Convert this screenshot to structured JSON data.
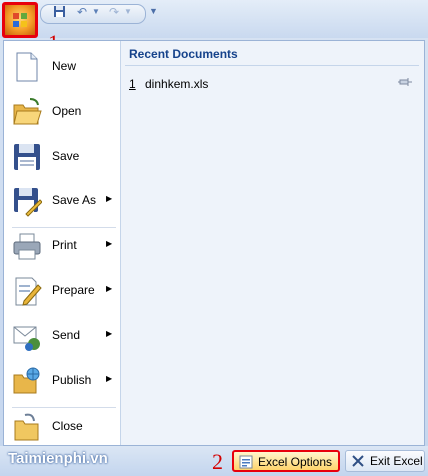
{
  "callouts": {
    "step1": "1",
    "step2": "2"
  },
  "menu": {
    "items": [
      {
        "label": "New",
        "icon": "new-document-icon",
        "has_submenu": false
      },
      {
        "label": "Open",
        "icon": "open-folder-icon",
        "has_submenu": false
      },
      {
        "label": "Save",
        "icon": "save-disk-icon",
        "has_submenu": false
      },
      {
        "label": "Save As",
        "icon": "save-as-icon",
        "has_submenu": true
      },
      {
        "label": "Print",
        "icon": "printer-icon",
        "has_submenu": true
      },
      {
        "label": "Prepare",
        "icon": "prepare-icon",
        "has_submenu": true
      },
      {
        "label": "Send",
        "icon": "send-icon",
        "has_submenu": true
      },
      {
        "label": "Publish",
        "icon": "publish-icon",
        "has_submenu": true
      },
      {
        "label": "Close",
        "icon": "close-folder-icon",
        "has_submenu": false
      }
    ]
  },
  "recent": {
    "title": "Recent Documents",
    "files": [
      {
        "num": "1",
        "name": "dinhkem.xls"
      }
    ]
  },
  "bottom": {
    "options_label": "Excel Options",
    "exit_label": "Exit Excel"
  },
  "watermark": "Taimienphi.vn",
  "colors": {
    "highlight": "#e8000c",
    "accent": "#15428b"
  }
}
